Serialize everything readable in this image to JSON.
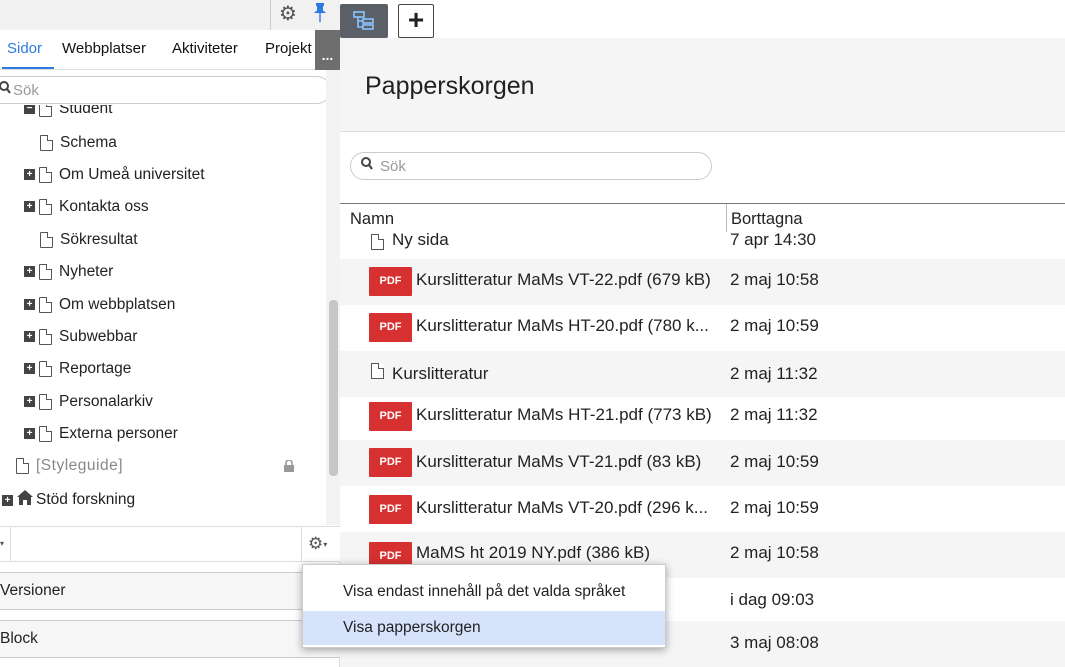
{
  "left_panel": {
    "tabs": [
      {
        "label": "Sidor",
        "active": true
      },
      {
        "label": "Webbplatser",
        "active": false
      },
      {
        "label": "Aktiviteter",
        "active": false
      },
      {
        "label": "Projekt",
        "active": false
      }
    ],
    "more_label": "...",
    "search_placeholder": "Sök",
    "tree": [
      {
        "label": "Student",
        "partial": true
      },
      {
        "label": "Schema",
        "expandable": false
      },
      {
        "label": "Om Umeå universitet",
        "expandable": true
      },
      {
        "label": "Kontakta oss",
        "expandable": true
      },
      {
        "label": "Sökresultat",
        "expandable": false
      },
      {
        "label": "Nyheter",
        "expandable": true
      },
      {
        "label": "Om webbplatsen",
        "expandable": true
      },
      {
        "label": "Subwebbar",
        "expandable": true
      },
      {
        "label": "Reportage",
        "expandable": true
      },
      {
        "label": "Personalarkiv",
        "expandable": true
      },
      {
        "label": "Externa personer",
        "expandable": true
      },
      {
        "label": "[Styleguide]",
        "expandable": false,
        "locked": true
      },
      {
        "label": "Stöd forskning",
        "expandable": true,
        "home": true
      }
    ],
    "sections": [
      {
        "label": "Versioner"
      },
      {
        "label": "Block"
      }
    ]
  },
  "right_panel": {
    "title": "Papperskorgen",
    "search_placeholder": "Sök",
    "columns": [
      "Namn",
      "Borttagna"
    ],
    "rows": [
      {
        "type": "page",
        "name": "Ny sida",
        "date": "7 apr 14:30",
        "partial": true
      },
      {
        "type": "pdf",
        "name": "Kurslitteratur MaMs VT-22.pdf (679 kB)",
        "date": "2 maj 10:58"
      },
      {
        "type": "pdf",
        "name": "Kurslitteratur MaMs HT-20.pdf (780 k...",
        "date": "2 maj 10:59"
      },
      {
        "type": "page",
        "name": "Kurslitteratur",
        "date": "2 maj 11:32"
      },
      {
        "type": "pdf",
        "name": "Kurslitteratur MaMs HT-21.pdf (773 kB)",
        "date": "2 maj 11:32"
      },
      {
        "type": "pdf",
        "name": "Kurslitteratur MaMs VT-21.pdf (83 kB)",
        "date": "2 maj 10:59"
      },
      {
        "type": "pdf",
        "name": "Kurslitteratur MaMs VT-20.pdf (296 k...",
        "date": "2 maj 10:59"
      },
      {
        "type": "pdf",
        "name": "MaMS ht 2019 NY.pdf (386 kB)",
        "date": "2 maj 10:58"
      },
      {
        "type": "page",
        "name": "",
        "date": "i dag 09:03"
      },
      {
        "type": "page",
        "name": "",
        "date": "3 maj 08:08"
      }
    ],
    "pdf_badge": "PDF"
  },
  "context_menu": {
    "items": [
      {
        "label": "Visa endast innehåll på det valda språket",
        "highlighted": false
      },
      {
        "label": "Visa papperskorgen",
        "highlighted": true
      }
    ]
  },
  "icons": {
    "gear": "⚙",
    "pin": "📌",
    "search": "🔍",
    "plus": "+",
    "lock": "🔒",
    "home": "⌂"
  }
}
